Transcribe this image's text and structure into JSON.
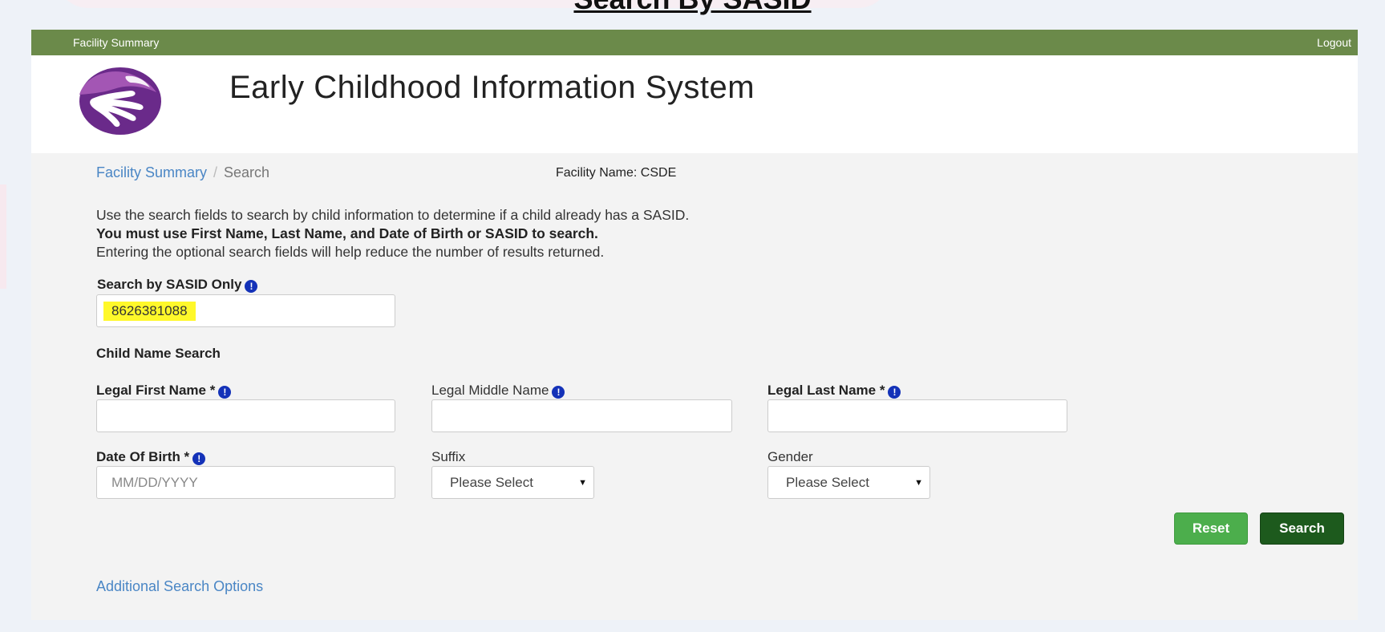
{
  "slide": {
    "title": "Search By SASID"
  },
  "topbar": {
    "facility_summary": "Facility Summary",
    "logout": "Logout"
  },
  "header": {
    "app_title": "Early Childhood Information System"
  },
  "breadcrumb": {
    "link": "Facility Summary",
    "separator": "/",
    "current": "Search"
  },
  "facility_name": "Facility Name: CSDE",
  "intro": {
    "line1": "Use the search fields to search by child information to determine if a child already has a SASID.",
    "line2": "You must use First Name, Last Name, and Date of Birth or SASID to search.",
    "line3": "Entering the optional search fields will help reduce the number of results returned."
  },
  "sasid": {
    "label": "Search by SASID Only",
    "value": "8626381088"
  },
  "child_name_search": {
    "heading": "Child Name Search",
    "first_name_label": "Legal First Name *",
    "middle_name_label": "Legal Middle Name",
    "last_name_label": "Legal Last Name *",
    "dob_label": "Date Of Birth *",
    "dob_placeholder": "MM/DD/YYYY",
    "suffix_label": "Suffix",
    "suffix_value": "Please Select",
    "gender_label": "Gender",
    "gender_value": "Please Select"
  },
  "buttons": {
    "reset": "Reset",
    "search": "Search"
  },
  "additional_options": "Additional Search Options",
  "icons": {
    "info": "info-icon",
    "caret": "caret-down-icon",
    "logo": "hands-logo-icon"
  },
  "colors": {
    "topbar": "#6b8a4a",
    "link": "#4a86c5",
    "reset_button": "#4cae4c",
    "search_button": "#1d5a1d",
    "highlight": "#fff82a",
    "info_icon": "#1432b8"
  }
}
